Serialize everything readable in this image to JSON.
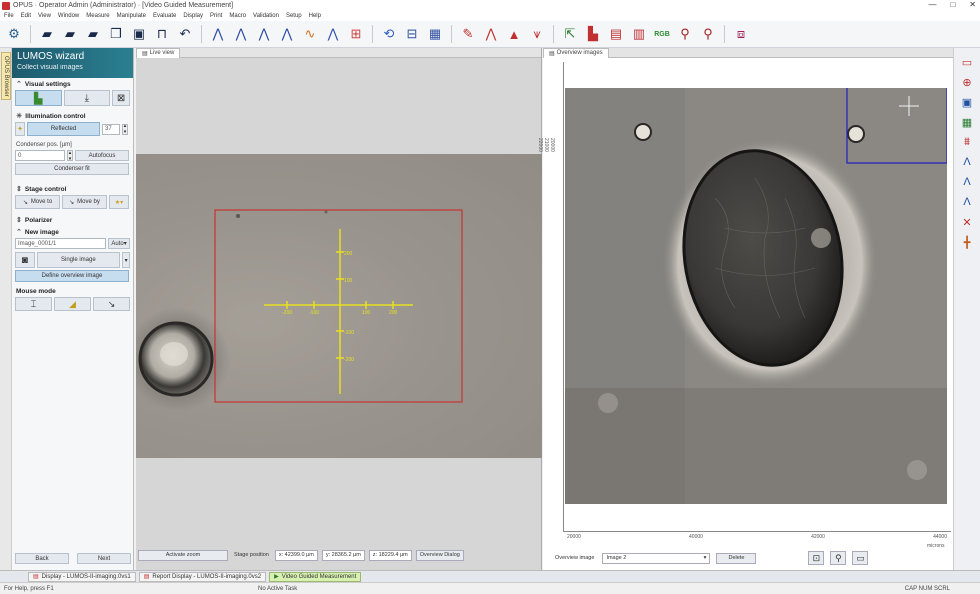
{
  "window": {
    "title": "OPUS · Operator Admin (Administrator) · [Video Guided Measurement]",
    "min": "—",
    "max": "□",
    "close": "✕"
  },
  "menu": [
    "File",
    "Edit",
    "View",
    "Window",
    "Measure",
    "Manipulate",
    "Evaluate",
    "Display",
    "Print",
    "Macro",
    "Validation",
    "Setup",
    "Help"
  ],
  "toolbar": {
    "rgb_label": "RGB",
    "icons": [
      "folder-open-icon",
      "folder-icon",
      "folder-save-icon",
      "copy-icon",
      "save-icon",
      "measure-icon",
      "undo-icon"
    ]
  },
  "wizard": {
    "title": "LUMOS wizard",
    "subtitle": "Collect visual images",
    "visual_settings_label": "Visual settings",
    "illumination_label": "Illumination control",
    "illumination_mode": "Reflected",
    "illumination_value": "37",
    "condenser_label": "Condenser pos. [µm]",
    "condenser_value": "0",
    "autofocus_label": "Autofocus",
    "condenser_fit_label": "Condenser fit",
    "stage_label": "Stage control",
    "move_to_label": "Move to",
    "move_by_label": "Move by",
    "polarizer_label": "Polarizer",
    "new_image_label": "New image",
    "image_name_value": "Image_0001/1",
    "auto_label": "Auto",
    "single_image_label": "Single image",
    "define_overview_label": "Define overview image",
    "mouse_mode_label": "Mouse mode",
    "back_label": "Back",
    "next_label": "Next"
  },
  "pane1": {
    "tab_label": "Live view",
    "activate_zoom": "Activate zoom",
    "stage_position_label": "Stage position",
    "x_value": "x: 42399.0 µm",
    "y_value": "y: 28365.2 µm",
    "z_value": "z: 18229.4 µm",
    "overview_dialog": "Overview Dialog",
    "crosshair_labels": {
      "top": "200",
      "right1": "100",
      "right2": "200",
      "left1": "-100",
      "left2": "-200",
      "mid": "100",
      "bottom1": "-100",
      "bottom2": "-200"
    }
  },
  "pane2": {
    "tab_label": "Overview images",
    "x_ticks": [
      "20000",
      "40000",
      "42000",
      "44000"
    ],
    "x_unit": "microns",
    "y_ticks": [
      "20000",
      "21000",
      "22000"
    ],
    "overview_label": "Overview image",
    "overview_value": "Image 2",
    "delete_label": "Delete"
  },
  "taskbar": {
    "items": [
      "Display - LUMOS-II-imaging.0vs1",
      "Report Display - LUMOS-II-imaging.0vs2",
      "Video Guided Measurement"
    ]
  },
  "status": {
    "help": "For Help, press F1",
    "center": "No Active Task",
    "right": "CAP  NUM  SCRL"
  },
  "colors": {
    "accent": "#1e5a6e",
    "selection_red": "#d02020",
    "crosshair_yellow": "#e8e020",
    "overview_rect_blue": "#2020c0"
  }
}
